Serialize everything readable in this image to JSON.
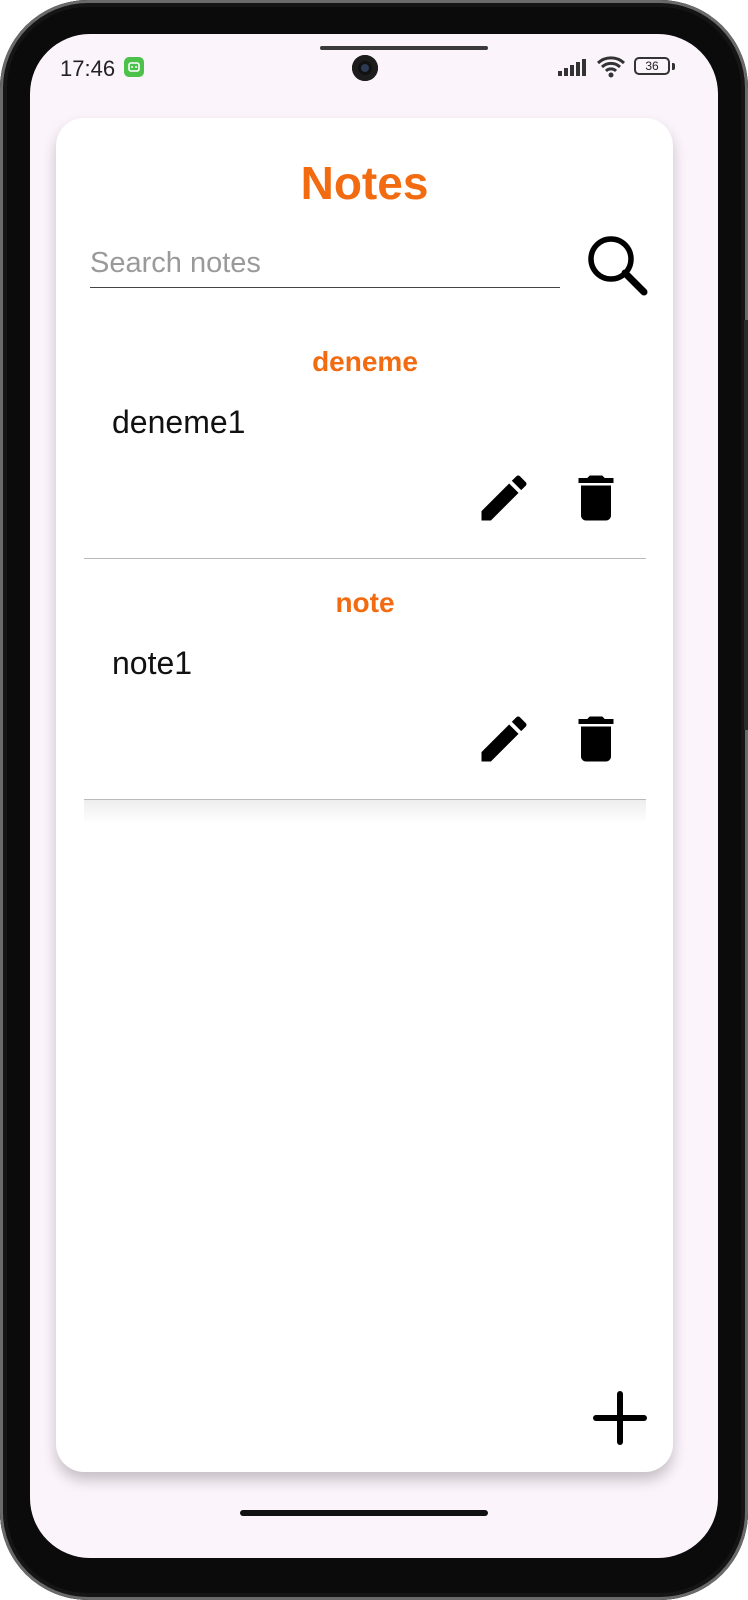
{
  "status_bar": {
    "time": "17:46",
    "battery": "36",
    "icons": [
      "app-notification-icon",
      "signal-icon",
      "wifi-icon",
      "battery-icon"
    ]
  },
  "app": {
    "title": "Notes",
    "accent_color": "#f26b10"
  },
  "search": {
    "placeholder": "Search notes",
    "value": "",
    "icon": "search-icon"
  },
  "notes": [
    {
      "title": "deneme",
      "body": "deneme1",
      "actions": [
        "edit-icon",
        "delete-icon"
      ]
    },
    {
      "title": "note",
      "body": "note1",
      "actions": [
        "edit-icon",
        "delete-icon"
      ]
    }
  ],
  "fab": {
    "icon": "add-icon"
  }
}
